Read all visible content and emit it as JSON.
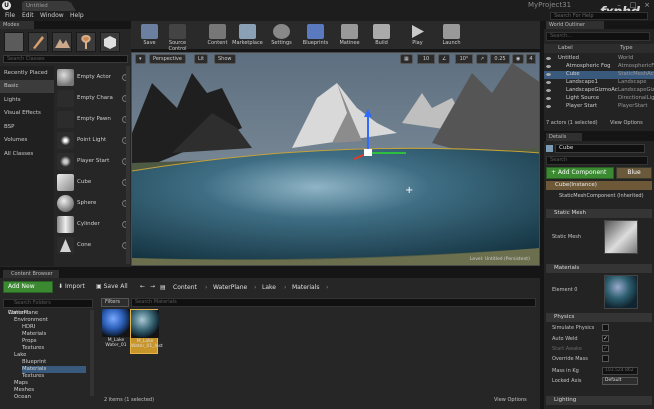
{
  "titlebar": {
    "tab": "Untitled",
    "project": "MyProject31",
    "watermark": "Fxphd"
  },
  "menu": [
    "File",
    "Edit",
    "Window",
    "Help"
  ],
  "search_help_placeholder": "Search For Help",
  "modes": {
    "tab": "Modes",
    "search_placeholder": "Search Classes",
    "categories": [
      "Recently Placed",
      "Basic",
      "Lights",
      "Visual Effects",
      "BSP",
      "Volumes",
      "All Classes"
    ],
    "selected_category": "Basic",
    "items": [
      "Empty Actor",
      "Empty Chara",
      "Empty Pawn",
      "Point Light",
      "Player Start",
      "Cube",
      "Sphere",
      "Cylinder",
      "Cone"
    ]
  },
  "toolbar": [
    {
      "label": "Save",
      "icon": "save-icon",
      "color": "#6b7fa0"
    },
    {
      "label": "Source Control",
      "icon": "source-control-icon",
      "color": "#4a4a4a"
    },
    {
      "label": "Content",
      "icon": "content-icon",
      "color": "#7a7a7a"
    },
    {
      "label": "Marketplace",
      "icon": "marketplace-icon",
      "color": "#8aa0b5"
    },
    {
      "label": "Settings",
      "icon": "gear-icon",
      "color": "#8a8a8a"
    },
    {
      "label": "Blueprints",
      "icon": "blueprint-icon",
      "color": "#5a7ac0"
    },
    {
      "label": "Matinee",
      "icon": "matinee-icon",
      "color": "#9a9a9a"
    },
    {
      "label": "Build",
      "icon": "build-icon",
      "color": "#b0b0b0"
    },
    {
      "label": "Play",
      "icon": "play-icon",
      "color": "#bababa"
    },
    {
      "label": "Launch",
      "icon": "launch-icon",
      "color": "#9a9a9a"
    }
  ],
  "viewport": {
    "perspective": "Perspective",
    "lit": "Lit",
    "show": "Show",
    "snap_grid": "10",
    "snap_rot": "10°",
    "snap_scale": "0.25",
    "cam_speed": "4",
    "level_label": "Level:  Untitled (Persistent)"
  },
  "outliner": {
    "tab": "World Outliner",
    "search_placeholder": "Search...",
    "col_label": "Label",
    "col_type": "Type",
    "rows": [
      {
        "label": "Untitled",
        "type": "World",
        "indent": 0
      },
      {
        "label": "Atmospheric Fog",
        "type": "AtmosphericFog",
        "indent": 1
      },
      {
        "label": "Cube",
        "type": "StaticMeshActor",
        "indent": 1,
        "selected": true
      },
      {
        "label": "Landscape1",
        "type": "Landscape",
        "indent": 1
      },
      {
        "label": "LandscapeGizmoActiveActor",
        "type": "LandscapeGizmo",
        "indent": 1
      },
      {
        "label": "Light Source",
        "type": "DirectionalLight",
        "indent": 1
      },
      {
        "label": "Player Start",
        "type": "PlayerStart",
        "indent": 1
      }
    ],
    "status": "7 actors (1 selected)",
    "view_options": "View Options"
  },
  "details": {
    "tab": "Details",
    "name": "Cube",
    "search_placeholder": "Search",
    "add_component": "+ Add Component",
    "blueprint": "Blue",
    "instance": "Cube(Instance)",
    "component": "StaticMeshComponent (Inherited)",
    "static_mesh_section": "Static Mesh",
    "static_mesh_label": "Static Mesh",
    "materials_section": "Materials",
    "element0": "Element 0",
    "physics_section": "Physics",
    "simulate": "Simulate Physics",
    "auto_weld": "Auto Weld",
    "start_awake": "Start Awake",
    "override_mass": "Override Mass",
    "mass": "Mass in Kg",
    "mass_value": "103.524 862",
    "locked_axis": "Locked Axis",
    "locked_axis_value": "Default",
    "lighting_section": "Lighting"
  },
  "content_browser": {
    "tab": "Content Browser",
    "add_new": "Add New",
    "import": "Import",
    "save_all": "Save All",
    "path": [
      "Content",
      "WaterPlane",
      "Lake",
      "Materials"
    ],
    "folder_search_placeholder": "Search Folders",
    "filters": "Filters",
    "asset_search_placeholder": "Search Materials",
    "tree": [
      {
        "label": "Content",
        "indent": 0
      },
      {
        "label": "WaterPlane",
        "indent": 1
      },
      {
        "label": "Environment",
        "indent": 1
      },
      {
        "label": "HDRI",
        "indent": 2
      },
      {
        "label": "Materials",
        "indent": 2
      },
      {
        "label": "Props",
        "indent": 2
      },
      {
        "label": "Textures",
        "indent": 2
      },
      {
        "label": "Lake",
        "indent": 1
      },
      {
        "label": "Blueprint",
        "indent": 2
      },
      {
        "label": "Materials",
        "indent": 2,
        "selected": true
      },
      {
        "label": "Textures",
        "indent": 2
      },
      {
        "label": "Maps",
        "indent": 1
      },
      {
        "label": "Meshes",
        "indent": 1
      },
      {
        "label": "Ocean",
        "indent": 1
      }
    ],
    "assets": [
      {
        "name": "M_Lake Water_01",
        "selected": false
      },
      {
        "name": "M_Lake Water_01_Inst",
        "selected": true
      }
    ],
    "status": "2 items (1 selected)",
    "view_options": "View Options"
  }
}
